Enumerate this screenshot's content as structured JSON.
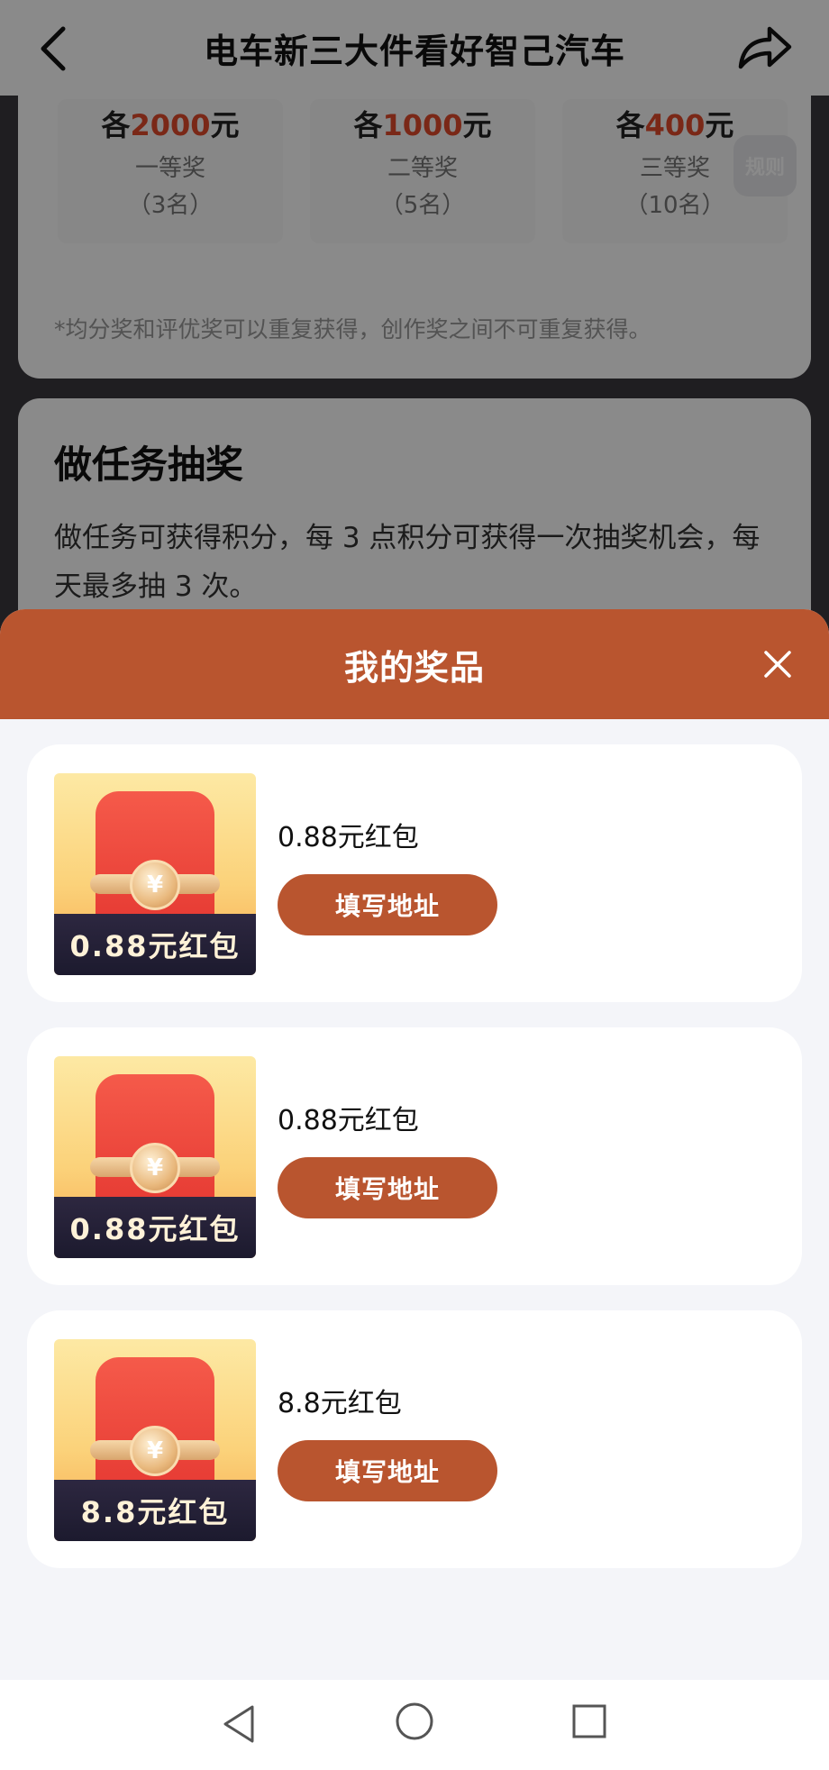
{
  "header": {
    "title": "电车新三大件看好智己汽车"
  },
  "prize_table": [
    {
      "prefix": "各",
      "amount": "2000",
      "unit": "元",
      "rank": "一等奖",
      "count": "（3名）"
    },
    {
      "prefix": "各",
      "amount": "1000",
      "unit": "元",
      "rank": "二等奖",
      "count": "（5名）"
    },
    {
      "prefix": "各",
      "amount": "400",
      "unit": "元",
      "rank": "三等奖",
      "count": "（10名）"
    }
  ],
  "rules_label": "规则",
  "prize_note": "*均分奖和评优奖可以重复获得，创作奖之间不可重复获得。",
  "lottery": {
    "title": "做任务抽奖",
    "desc": "做任务可获得积分，每 3 点积分可获得一次抽奖机会，每天最多抽 3 次。"
  },
  "sheet": {
    "title": "我的奖品",
    "items": [
      {
        "name": "0.88元红包",
        "thumb_label": "0.88元红包",
        "coin": "¥",
        "button": "填写地址"
      },
      {
        "name": "0.88元红包",
        "thumb_label": "0.88元红包",
        "coin": "¥",
        "button": "填写地址"
      },
      {
        "name": "8.8元红包",
        "thumb_label": "8.8元红包",
        "coin": "¥",
        "button": "填写地址"
      }
    ]
  },
  "colors": {
    "accent": "#b9552f",
    "highlight": "#e24a2c",
    "sheet_bg": "#f4f5f9"
  },
  "icons": [
    "back-arrow-icon",
    "share-icon",
    "close-icon",
    "nav-back-icon",
    "nav-home-icon",
    "nav-recent-icon"
  ]
}
